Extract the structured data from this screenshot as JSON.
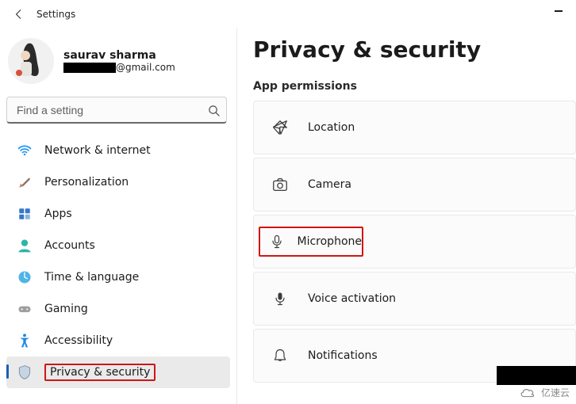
{
  "titlebar": {
    "title": "Settings"
  },
  "profile": {
    "name": "saurav sharma",
    "email_suffix": "@gmail.com"
  },
  "search": {
    "placeholder": "Find a setting"
  },
  "sidebar": {
    "items": [
      {
        "label": "Network & internet"
      },
      {
        "label": "Personalization"
      },
      {
        "label": "Apps"
      },
      {
        "label": "Accounts"
      },
      {
        "label": "Time & language"
      },
      {
        "label": "Gaming"
      },
      {
        "label": "Accessibility"
      },
      {
        "label": "Privacy & security"
      }
    ]
  },
  "page": {
    "title": "Privacy & security",
    "section": "App permissions",
    "items": [
      {
        "label": "Location"
      },
      {
        "label": "Camera"
      },
      {
        "label": "Microphone"
      },
      {
        "label": "Voice activation"
      },
      {
        "label": "Notifications"
      }
    ]
  },
  "watermark": {
    "text": "亿速云"
  }
}
